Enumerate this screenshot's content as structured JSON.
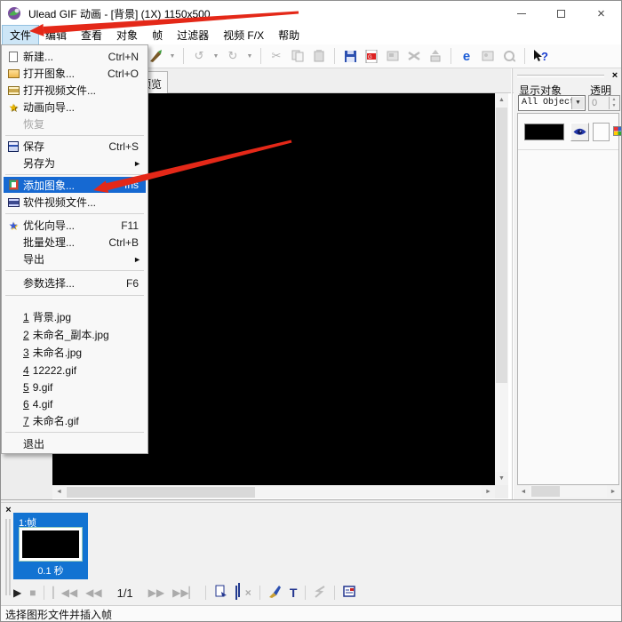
{
  "titlebar": {
    "title": "Ulead GIF 动画 - [背景] (1X) 1150x500"
  },
  "menubar": {
    "items": [
      "文件",
      "编辑",
      "查看",
      "对象",
      "帧",
      "过滤器",
      "视频 F/X",
      "帮助"
    ],
    "active_item": "文件"
  },
  "file_menu": {
    "items": [
      {
        "label": "新建...",
        "shortcut": "Ctrl+N"
      },
      {
        "label": "打开图象...",
        "shortcut": "Ctrl+O"
      },
      {
        "label": "打开视频文件...",
        "shortcut": ""
      },
      {
        "label": "动画向导...",
        "shortcut": ""
      },
      {
        "label": "恢复",
        "shortcut": ""
      },
      {
        "label": "保存",
        "shortcut": "Ctrl+S"
      },
      {
        "label": "另存为",
        "shortcut": ""
      },
      {
        "label": "添加图象...",
        "shortcut": "Ins"
      },
      {
        "label": "软件视频文件...",
        "shortcut": ""
      },
      {
        "label": "优化向导...",
        "shortcut": "F11"
      },
      {
        "label": "批量处理...",
        "shortcut": "Ctrl+B"
      },
      {
        "label": "导出",
        "shortcut": ""
      },
      {
        "label": "参数选择...",
        "shortcut": "F6"
      },
      {
        "label": "退出",
        "shortcut": ""
      }
    ],
    "recent": [
      {
        "num": "1",
        "name": "背景.jpg"
      },
      {
        "num": "2",
        "name": "未命名_副本.jpg"
      },
      {
        "num": "3",
        "name": "未命名.jpg"
      },
      {
        "num": "4",
        "name": "12222.gif"
      },
      {
        "num": "5",
        "name": "9.gif"
      },
      {
        "num": "6",
        "name": "4.gif"
      },
      {
        "num": "7",
        "name": "未命名.gif"
      }
    ],
    "highlighted_item": "添加图象..."
  },
  "tabbar": {
    "preview_tab": "预览"
  },
  "right_panel": {
    "show_object_label": "显示对象",
    "transparency_label": "透明",
    "object_dropdown_value": "All Object:",
    "transparency_value": "0"
  },
  "frame_panel": {
    "frame_caption": "1:帧",
    "frame_duration": "0.1 秒",
    "frame_position": "1/1"
  },
  "statusbar": {
    "text": "选择图形文件并插入帧"
  },
  "glyphs": {
    "play": "▶",
    "stop": "■",
    "first": "▏◀◀",
    "prev": "◀◀",
    "next": "▶▶",
    "last": "▶▶▏",
    "dropdown": "▼",
    "submenu": "►",
    "scroll_up": "▲",
    "scroll_down": "▼",
    "scroll_left": "◄",
    "scroll_right": "►",
    "undo": "↺",
    "redo": "↻",
    "cut": "✂",
    "ie": "e",
    "help": "?",
    "delete": "×",
    "text_tool": "T",
    "spin": "▲▼",
    "minimize": "",
    "close": "×",
    "panel_close": "×"
  },
  "colors": {
    "menu_highlight": "#1669d2",
    "frame_selected": "#1273d2",
    "arrow_red": "#e42818",
    "menubar_active_bg": "#cde6f7"
  }
}
